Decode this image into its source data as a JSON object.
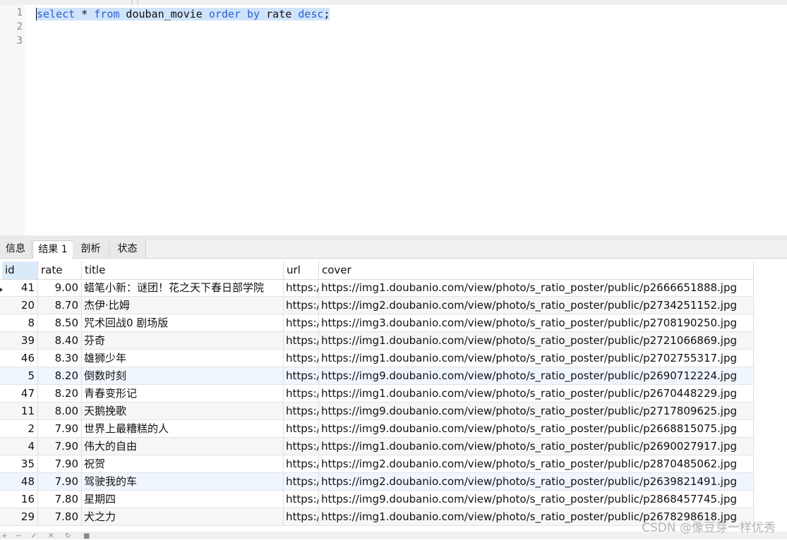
{
  "editor": {
    "line_numbers": [
      "1",
      "2",
      "3"
    ],
    "query_parts": [
      {
        "text": "select",
        "kw": true
      },
      {
        "text": " * ",
        "kw": false
      },
      {
        "text": "from",
        "kw": true
      },
      {
        "text": " douban_movie ",
        "kw": false
      },
      {
        "text": "order",
        "kw": true
      },
      {
        "text": " ",
        "kw": false
      },
      {
        "text": "by",
        "kw": true
      },
      {
        "text": " rate ",
        "kw": false
      },
      {
        "text": "desc",
        "kw": true
      },
      {
        "text": ";",
        "kw": false
      }
    ]
  },
  "result_tabs": [
    {
      "label": "信息",
      "active": false
    },
    {
      "label": "结果 1",
      "active": true
    },
    {
      "label": "剖析",
      "active": false
    },
    {
      "label": "状态",
      "active": false
    }
  ],
  "grid": {
    "columns": [
      "id",
      "rate",
      "title",
      "url",
      "cover"
    ],
    "rows": [
      {
        "id": "41",
        "rate": "9.00",
        "title": "蜡笔小新：谜团！花之天下春日部学院",
        "url": "https:/",
        "cover": "https://img1.doubanio.com/view/photo/s_ratio_poster/public/p2666651888.jpg"
      },
      {
        "id": "20",
        "rate": "8.70",
        "title": "杰伊·比姆",
        "url": "https:/",
        "cover": "https://img2.doubanio.com/view/photo/s_ratio_poster/public/p2734251152.jpg"
      },
      {
        "id": "8",
        "rate": "8.50",
        "title": "咒术回战0 剧场版",
        "url": "https:/",
        "cover": "https://img3.doubanio.com/view/photo/s_ratio_poster/public/p2708190250.jpg"
      },
      {
        "id": "39",
        "rate": "8.40",
        "title": "芬奇",
        "url": "https:/",
        "cover": "https://img1.doubanio.com/view/photo/s_ratio_poster/public/p2721066869.jpg"
      },
      {
        "id": "46",
        "rate": "8.30",
        "title": "雄狮少年",
        "url": "https:/",
        "cover": "https://img1.doubanio.com/view/photo/s_ratio_poster/public/p2702755317.jpg"
      },
      {
        "id": "5",
        "rate": "8.20",
        "title": "倒数时刻",
        "url": "https:/",
        "cover": "https://img9.doubanio.com/view/photo/s_ratio_poster/public/p2690712224.jpg"
      },
      {
        "id": "47",
        "rate": "8.20",
        "title": "青春变形记",
        "url": "https:/",
        "cover": "https://img1.doubanio.com/view/photo/s_ratio_poster/public/p2670448229.jpg"
      },
      {
        "id": "11",
        "rate": "8.00",
        "title": "天鹅挽歌",
        "url": "https:/",
        "cover": "https://img9.doubanio.com/view/photo/s_ratio_poster/public/p2717809625.jpg"
      },
      {
        "id": "2",
        "rate": "7.90",
        "title": "世界上最糟糕的人",
        "url": "https:/",
        "cover": "https://img9.doubanio.com/view/photo/s_ratio_poster/public/p2668815075.jpg"
      },
      {
        "id": "4",
        "rate": "7.90",
        "title": "伟大的自由",
        "url": "https:/",
        "cover": "https://img1.doubanio.com/view/photo/s_ratio_poster/public/p2690027917.jpg"
      },
      {
        "id": "35",
        "rate": "7.90",
        "title": "祝贺",
        "url": "https:/",
        "cover": "https://img2.doubanio.com/view/photo/s_ratio_poster/public/p2870485062.jpg"
      },
      {
        "id": "48",
        "rate": "7.90",
        "title": "驾驶我的车",
        "url": "https:/",
        "cover": "https://img2.doubanio.com/view/photo/s_ratio_poster/public/p2639821491.jpg"
      },
      {
        "id": "16",
        "rate": "7.80",
        "title": "星期四",
        "url": "https:/",
        "cover": "https://img9.doubanio.com/view/photo/s_ratio_poster/public/p2868457745.jpg"
      },
      {
        "id": "29",
        "rate": "7.80",
        "title": "犬之力",
        "url": "https:/",
        "cover": "https://img1.doubanio.com/view/photo/s_ratio_poster/public/p2678298618.jpg"
      }
    ]
  },
  "watermark": "CSDN @像豆芽一样优秀"
}
